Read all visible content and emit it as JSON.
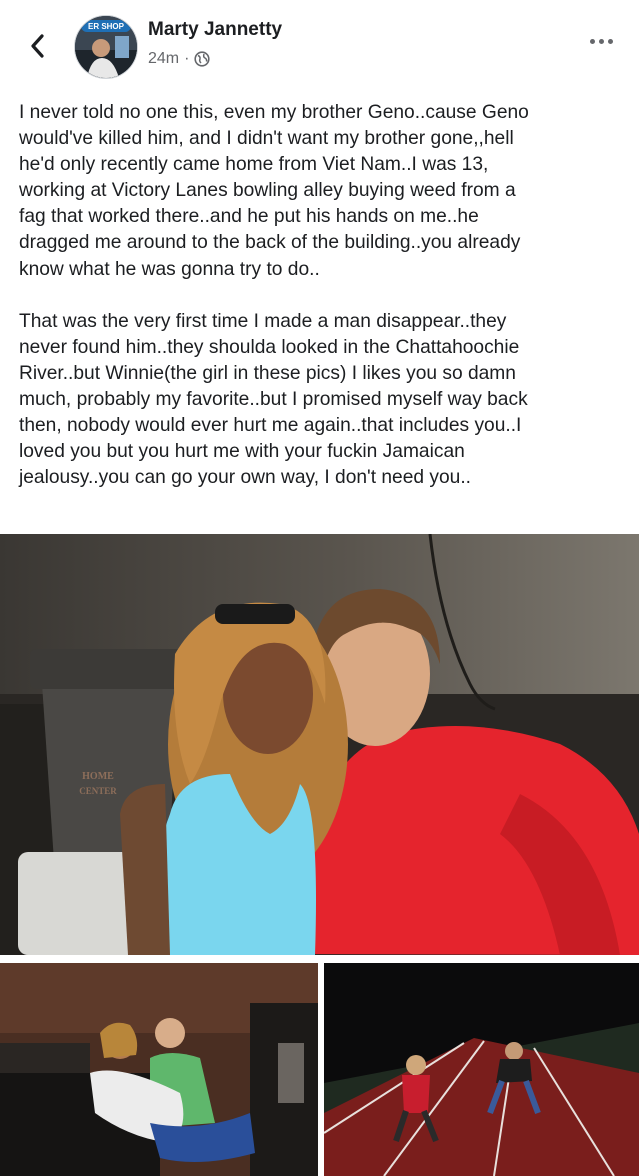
{
  "header": {
    "author_name": "Marty Jannetty",
    "timestamp": "24m",
    "avatar_badge": "ER SHOP",
    "privacy_icon": "globe-icon",
    "back_icon": "chevron-left-icon",
    "more_icon": "more-horizontal-icon"
  },
  "post": {
    "paragraph_1": "I never told no one this, even my brother Geno..cause Geno\nwould've killed him, and I didn't want my brother gone,,hell\nhe'd only recently came home from Viet Nam..I was 13,\nworking at Victory Lanes bowling alley buying weed from a\nfag that worked there..and he put his hands on me..he\ndragged me around to the back of the building..you already\nknow what he was gonna try to do..",
    "paragraph_2": "That was the very first time I made a man disappear..they\nnever found him..they shoulda looked in the Chattahoochie\nRiver..but Winnie(the girl in these pics) I likes you so damn\nmuch, probably my favorite..but I promised myself way back\nthen, nobody would ever hurt me again..that includes you..I\nloved you but you hurt me with your fuckin Jamaican\njealousy..you can go your own way, I don't need you.."
  },
  "photos": {
    "main_can_text_1": "HOME",
    "main_can_text_2": "CENTER"
  },
  "colors": {
    "text": "#1c1e21",
    "secondary": "#65676b",
    "background": "#ffffff"
  }
}
